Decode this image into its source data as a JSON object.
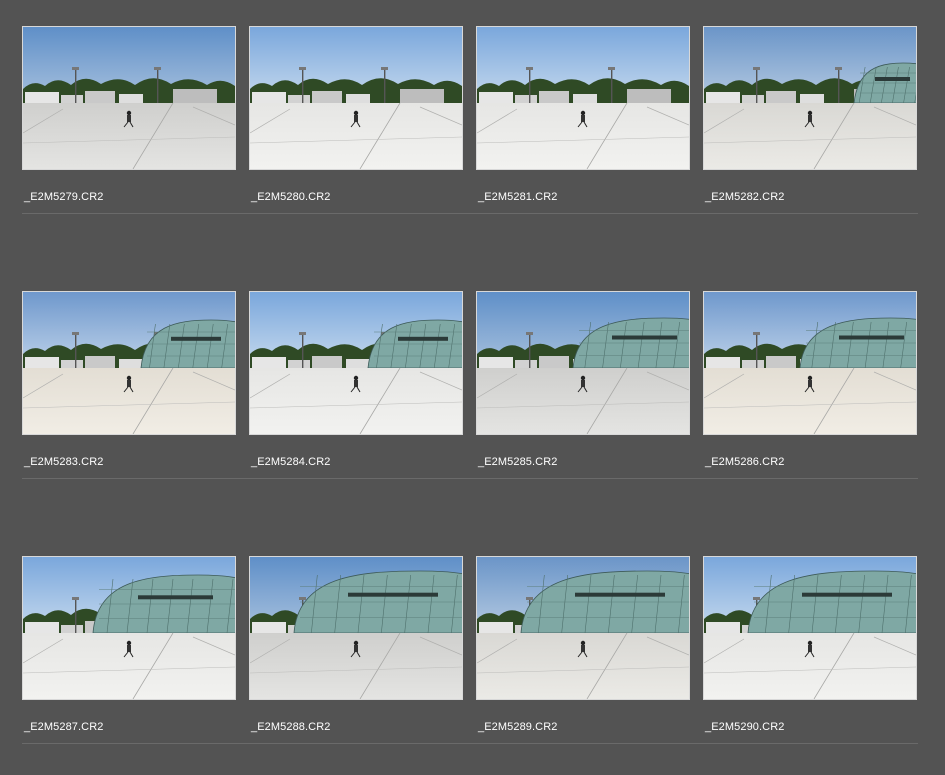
{
  "files": [
    {
      "name": "_E2M5279.CR2",
      "tone": "cool",
      "dome": 0
    },
    {
      "name": "_E2M5280.CR2",
      "tone": "bright",
      "dome": 0
    },
    {
      "name": "_E2M5281.CR2",
      "tone": "bright",
      "dome": 0
    },
    {
      "name": "_E2M5282.CR2",
      "tone": "neutral",
      "dome": 1
    },
    {
      "name": "_E2M5283.CR2",
      "tone": "warm",
      "dome": 2
    },
    {
      "name": "_E2M5284.CR2",
      "tone": "bright",
      "dome": 2
    },
    {
      "name": "_E2M5285.CR2",
      "tone": "cool",
      "dome": 3
    },
    {
      "name": "_E2M5286.CR2",
      "tone": "warm",
      "dome": 3
    },
    {
      "name": "_E2M5287.CR2",
      "tone": "bright",
      "dome": 4
    },
    {
      "name": "_E2M5288.CR2",
      "tone": "cool",
      "dome": 5
    },
    {
      "name": "_E2M5289.CR2",
      "tone": "neutral",
      "dome": 5
    },
    {
      "name": "_E2M5290.CR2",
      "tone": "bright",
      "dome": 5
    }
  ],
  "tones": {
    "cool": {
      "sky1": "#5f8fc8",
      "sky2": "#a9c2de",
      "ground": "#cfcfcd",
      "ground2": "#e4e4e2"
    },
    "bright": {
      "sky1": "#7aa7dc",
      "sky2": "#c7daee",
      "ground": "#e6e6e4",
      "ground2": "#f2f2f0"
    },
    "neutral": {
      "sky1": "#6b95c8",
      "sky2": "#b6cbe2",
      "ground": "#d9d8d4",
      "ground2": "#ebeae6"
    },
    "warm": {
      "sky1": "#6f98cc",
      "sky2": "#bfd3ea",
      "ground": "#e3ded4",
      "ground2": "#f1ede5"
    }
  }
}
